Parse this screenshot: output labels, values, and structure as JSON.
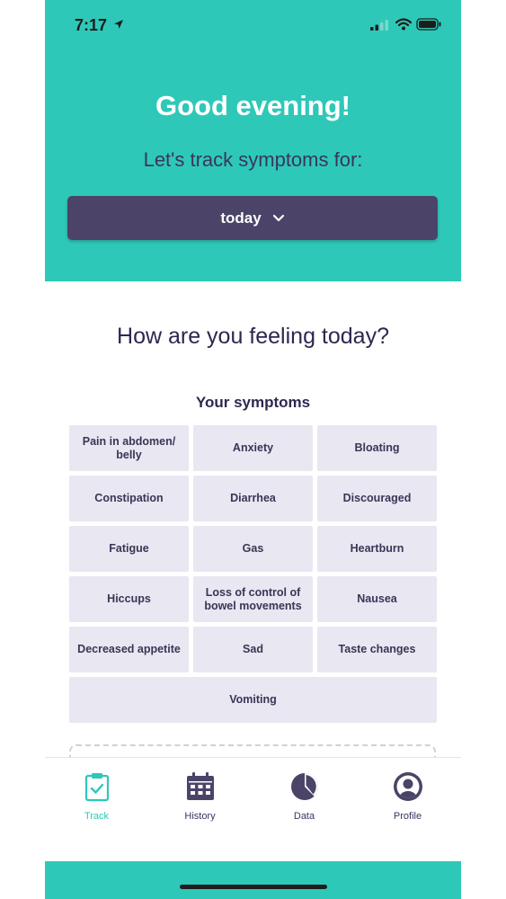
{
  "status_bar": {
    "time": "7:17"
  },
  "header": {
    "greeting": "Good evening!",
    "prompt": "Let's track symptoms for:",
    "date_selector": "today"
  },
  "main": {
    "question": "How are you feeling today?",
    "symptoms_heading": "Your symptoms",
    "symptoms": [
      "Pain in abdomen/ belly",
      "Anxiety",
      "Bloating",
      "Constipation",
      "Diarrhea",
      "Discouraged",
      "Fatigue",
      "Gas",
      "Heartburn",
      "Hiccups",
      "Loss of control of bowel movements",
      "Nausea",
      "Decreased appetite",
      "Sad",
      "Taste changes",
      "Vomiting"
    ]
  },
  "tabbar": {
    "tabs": [
      {
        "label": "Track",
        "icon": "clipboard-check-icon",
        "active": true
      },
      {
        "label": "History",
        "icon": "calendar-icon",
        "active": false
      },
      {
        "label": "Data",
        "icon": "pie-chart-icon",
        "active": false
      },
      {
        "label": "Profile",
        "icon": "user-icon",
        "active": false
      }
    ]
  },
  "colors": {
    "accent": "#2ec8b8",
    "dark_button": "#4b4468",
    "chip_bg": "#e8e7f2",
    "text_dark": "#2c2850"
  }
}
